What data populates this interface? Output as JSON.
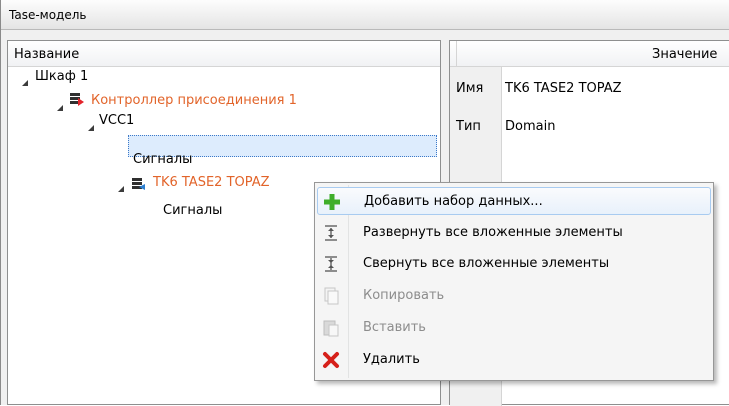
{
  "window": {
    "title": "Tase-модель"
  },
  "tree": {
    "header": "Название",
    "nodes": [
      {
        "label": "Шкаф 1"
      },
      {
        "label": "Контроллер присоединения 1",
        "color": "#e2642a"
      },
      {
        "label": "VCC1"
      },
      {
        "label": "Сигналы"
      },
      {
        "label": "TK6 TASE2 TOPAZ",
        "color": "#e2642a"
      },
      {
        "label": "Сигналы"
      }
    ]
  },
  "properties": {
    "header": "Значение",
    "rows": [
      {
        "key": "Имя",
        "value": "TK6 TASE2 TOPAZ"
      },
      {
        "key": "Тип",
        "value": "Domain"
      }
    ]
  },
  "context_menu": {
    "items": [
      {
        "label": "Добавить набор данных...",
        "icon": "plus-icon",
        "enabled": true,
        "highlighted": true
      },
      {
        "label": "Развернуть все вложенные элементы",
        "icon": "expand-all-icon",
        "enabled": true
      },
      {
        "label": "Свернуть все вложенные элементы",
        "icon": "collapse-all-icon",
        "enabled": true
      },
      {
        "label": "Копировать",
        "icon": "copy-icon",
        "enabled": false
      },
      {
        "label": "Вставить",
        "icon": "paste-icon",
        "enabled": false
      },
      {
        "label": "Удалить",
        "icon": "delete-icon",
        "enabled": true
      }
    ]
  }
}
